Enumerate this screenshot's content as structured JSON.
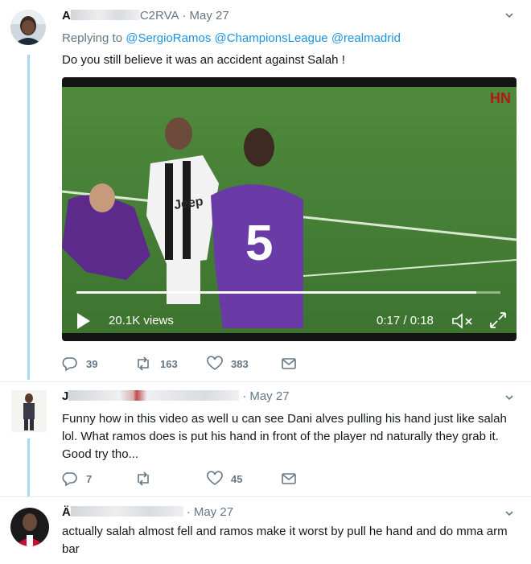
{
  "tweets": [
    {
      "author_start": "A",
      "author_end": "C2RVA",
      "separator": "·",
      "date": "May 27",
      "replying_label": "Replying to",
      "mentions": [
        "@SergioRamos",
        "@ChampionsLeague",
        "@realmadrid"
      ],
      "text": "Do you still believe it was an accident against Salah !",
      "video": {
        "watermark": "HN",
        "views": "20.1K views",
        "time": "0:17 / 0:18",
        "progress": 0.944,
        "jersey_number": "5",
        "sponsor": "Jeep"
      },
      "actions": {
        "replies": "39",
        "retweets": "163",
        "likes": "383"
      }
    },
    {
      "author_start": "J",
      "separator": "·",
      "date": "May 27",
      "text": "Funny how in this video as well u can see Dani alves pulling his hand just like salah lol. What ramos does is put his hand in front of the player nd naturally they grab it. Good try tho...",
      "actions": {
        "replies": "7",
        "retweets": "",
        "likes": "45"
      }
    },
    {
      "author_start": "Ä",
      "separator": "·",
      "date": "May 27",
      "text": "actually salah almost fell and ramos make it worst by pull he hand and do mma arm bar"
    }
  ],
  "colors": {
    "accent": "#1b95e0",
    "thread": "#a4d9f3",
    "muted": "#657786"
  },
  "icons": [
    "reply-icon",
    "retweet-icon",
    "like-icon",
    "dm-icon",
    "chevron-down-icon",
    "play-icon",
    "mute-icon",
    "fullscreen-icon"
  ]
}
